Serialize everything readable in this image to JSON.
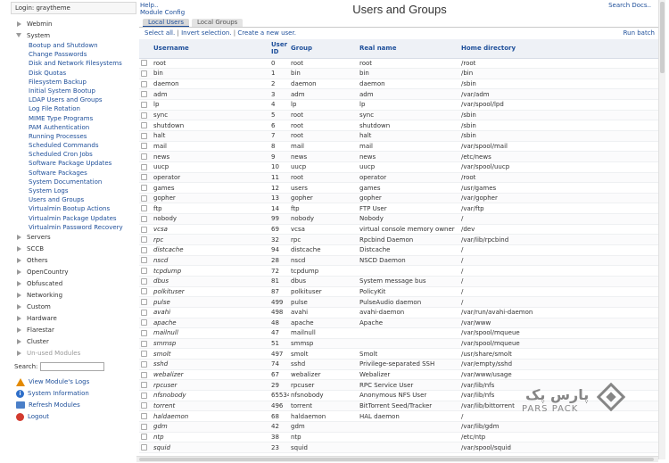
{
  "sidebar": {
    "login_text": "Login: graytheme",
    "categories_top": [
      {
        "label": "Webmin",
        "open": false
      }
    ],
    "system": {
      "label": "System",
      "items": [
        "Bootup and Shutdown",
        "Change Passwords",
        "Disk and Network Filesystems",
        "Disk Quotas",
        "Filesystem Backup",
        "Initial System Bootup",
        "LDAP Users and Groups",
        "Log File Rotation",
        "MIME Type Programs",
        "PAM Authentication",
        "Running Processes",
        "Scheduled Commands",
        "Scheduled Cron Jobs",
        "Software Package Updates",
        "Software Packages",
        "System Documentation",
        "System Logs",
        "Users and Groups",
        "Virtualmin Bootup Actions",
        "Virtualmin Package Updates",
        "Virtualmin Password Recovery"
      ]
    },
    "categories_bottom": [
      "Servers",
      "SCCB",
      "Others",
      "OpenCountry",
      "Obfuscated",
      "Networking",
      "Custom",
      "Hardware",
      "Flarestar",
      "Cluster",
      "Un-used Modules"
    ],
    "search_label": "Search:",
    "links": {
      "view_logs": "View Module's Logs",
      "system_info": "System Information",
      "refresh": "Refresh Modules",
      "logout": "Logout"
    }
  },
  "header": {
    "help": "Help..",
    "module_config": "Module Config",
    "title": "Users and Groups",
    "search_docs": "Search Docs.."
  },
  "tabs": [
    "Local Users",
    "Local Groups"
  ],
  "actions": {
    "select_all": "Select all.",
    "invert": "Invert selection.",
    "create": "Create a new user.",
    "run_batch": "Run batch"
  },
  "table": {
    "columns": {
      "username": "Username",
      "userid": "User ID",
      "group": "Group",
      "realname": "Real name",
      "home": "Home directory"
    },
    "rows": [
      {
        "u": "root",
        "id": "0",
        "g": "root",
        "r": "root",
        "h": "/root",
        "sys": false
      },
      {
        "u": "bin",
        "id": "1",
        "g": "bin",
        "r": "bin",
        "h": "/bin",
        "sys": false
      },
      {
        "u": "daemon",
        "id": "2",
        "g": "daemon",
        "r": "daemon",
        "h": "/sbin",
        "sys": false
      },
      {
        "u": "adm",
        "id": "3",
        "g": "adm",
        "r": "adm",
        "h": "/var/adm",
        "sys": false
      },
      {
        "u": "lp",
        "id": "4",
        "g": "lp",
        "r": "lp",
        "h": "/var/spool/lpd",
        "sys": false
      },
      {
        "u": "sync",
        "id": "5",
        "g": "root",
        "r": "sync",
        "h": "/sbin",
        "sys": false
      },
      {
        "u": "shutdown",
        "id": "6",
        "g": "root",
        "r": "shutdown",
        "h": "/sbin",
        "sys": false
      },
      {
        "u": "halt",
        "id": "7",
        "g": "root",
        "r": "halt",
        "h": "/sbin",
        "sys": false
      },
      {
        "u": "mail",
        "id": "8",
        "g": "mail",
        "r": "mail",
        "h": "/var/spool/mail",
        "sys": false
      },
      {
        "u": "news",
        "id": "9",
        "g": "news",
        "r": "news",
        "h": "/etc/news",
        "sys": false
      },
      {
        "u": "uucp",
        "id": "10",
        "g": "uucp",
        "r": "uucp",
        "h": "/var/spool/uucp",
        "sys": false
      },
      {
        "u": "operator",
        "id": "11",
        "g": "root",
        "r": "operator",
        "h": "/root",
        "sys": false
      },
      {
        "u": "games",
        "id": "12",
        "g": "users",
        "r": "games",
        "h": "/usr/games",
        "sys": false
      },
      {
        "u": "gopher",
        "id": "13",
        "g": "gopher",
        "r": "gopher",
        "h": "/var/gopher",
        "sys": false
      },
      {
        "u": "ftp",
        "id": "14",
        "g": "ftp",
        "r": "FTP User",
        "h": "/var/ftp",
        "sys": false
      },
      {
        "u": "nobody",
        "id": "99",
        "g": "nobody",
        "r": "Nobody",
        "h": "/",
        "sys": false
      },
      {
        "u": "vcsa",
        "id": "69",
        "g": "vcsa",
        "r": "virtual console memory owner",
        "h": "/dev",
        "sys": true
      },
      {
        "u": "rpc",
        "id": "32",
        "g": "rpc",
        "r": "Rpcbind Daemon",
        "h": "/var/lib/rpcbind",
        "sys": true
      },
      {
        "u": "distcache",
        "id": "94",
        "g": "distcache",
        "r": "Distcache",
        "h": "/",
        "sys": true
      },
      {
        "u": "nscd",
        "id": "28",
        "g": "nscd",
        "r": "NSCD Daemon",
        "h": "/",
        "sys": true
      },
      {
        "u": "tcpdump",
        "id": "72",
        "g": "tcpdump",
        "r": "",
        "h": "/",
        "sys": true
      },
      {
        "u": "dbus",
        "id": "81",
        "g": "dbus",
        "r": "System message bus",
        "h": "/",
        "sys": true
      },
      {
        "u": "polkituser",
        "id": "87",
        "g": "polkituser",
        "r": "PolicyKit",
        "h": "/",
        "sys": true
      },
      {
        "u": "pulse",
        "id": "499",
        "g": "pulse",
        "r": "PulseAudio daemon",
        "h": "/",
        "sys": true
      },
      {
        "u": "avahi",
        "id": "498",
        "g": "avahi",
        "r": "avahi-daemon",
        "h": "/var/run/avahi-daemon",
        "sys": true
      },
      {
        "u": "apache",
        "id": "48",
        "g": "apache",
        "r": "Apache",
        "h": "/var/www",
        "sys": true
      },
      {
        "u": "mailnull",
        "id": "47",
        "g": "mailnull",
        "r": "",
        "h": "/var/spool/mqueue",
        "sys": true
      },
      {
        "u": "smmsp",
        "id": "51",
        "g": "smmsp",
        "r": "",
        "h": "/var/spool/mqueue",
        "sys": true
      },
      {
        "u": "smolt",
        "id": "497",
        "g": "smolt",
        "r": "Smolt",
        "h": "/usr/share/smolt",
        "sys": true
      },
      {
        "u": "sshd",
        "id": "74",
        "g": "sshd",
        "r": "Privilege-separated SSH",
        "h": "/var/empty/sshd",
        "sys": true
      },
      {
        "u": "webalizer",
        "id": "67",
        "g": "webalizer",
        "r": "Webalizer",
        "h": "/var/www/usage",
        "sys": true
      },
      {
        "u": "rpcuser",
        "id": "29",
        "g": "rpcuser",
        "r": "RPC Service User",
        "h": "/var/lib/nfs",
        "sys": true
      },
      {
        "u": "nfsnobody",
        "id": "65534",
        "g": "nfsnobody",
        "r": "Anonymous NFS User",
        "h": "/var/lib/nfs",
        "sys": true
      },
      {
        "u": "torrent",
        "id": "496",
        "g": "torrent",
        "r": "BitTorrent Seed/Tracker",
        "h": "/var/lib/bittorrent",
        "sys": true
      },
      {
        "u": "haldaemon",
        "id": "68",
        "g": "haldaemon",
        "r": "HAL daemon",
        "h": "/",
        "sys": true
      },
      {
        "u": "gdm",
        "id": "42",
        "g": "gdm",
        "r": "",
        "h": "/var/lib/gdm",
        "sys": true
      },
      {
        "u": "ntp",
        "id": "38",
        "g": "ntp",
        "r": "",
        "h": "/etc/ntp",
        "sys": true
      },
      {
        "u": "squid",
        "id": "23",
        "g": "squid",
        "r": "",
        "h": "/var/spool/squid",
        "sys": true
      }
    ]
  },
  "watermark": {
    "text_fa": "پارس پک",
    "text_en": "PARS PACK"
  }
}
